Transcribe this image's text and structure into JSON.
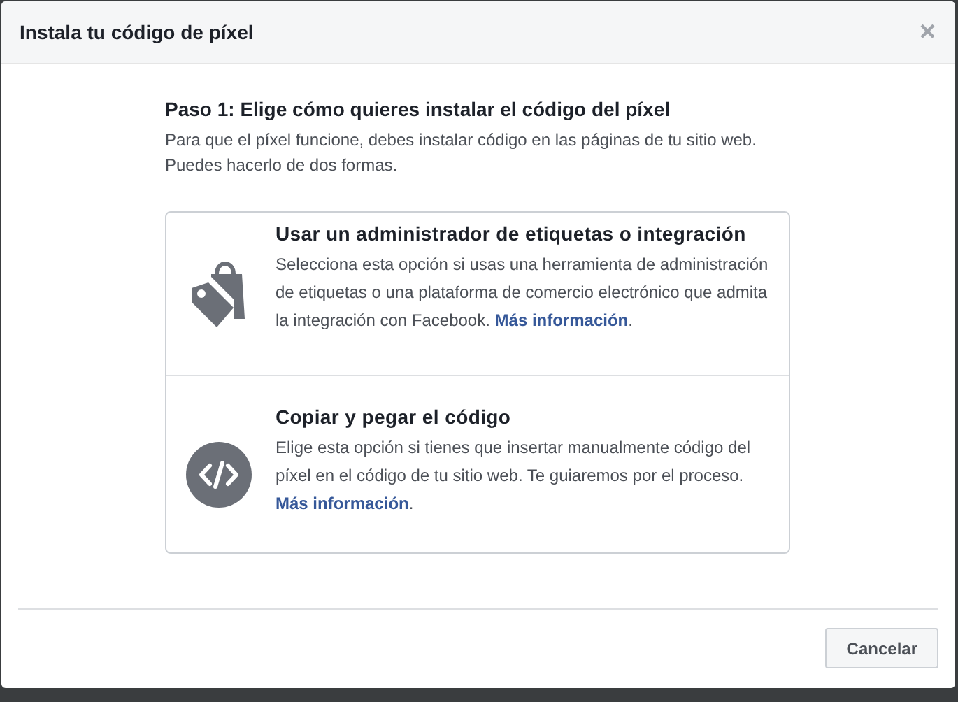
{
  "dialog": {
    "title": "Instala tu código de píxel",
    "close": "×"
  },
  "step": {
    "heading": "Paso 1: Elige cómo quieres instalar el código del píxel",
    "text": "Para que el píxel funcione, debes instalar código en las páginas de tu sitio web. Puedes hacerlo de dos formas."
  },
  "options": [
    {
      "kind": "tag",
      "title": "Usar un administrador de etiquetas o integración",
      "description": "Selecciona esta opción si usas una herramienta de administración de etiquetas o una plataforma de comercio electrónico que admita la integración con Facebook.",
      "link": "Más información",
      "after": "."
    },
    {
      "kind": "code",
      "title": "Copiar y pegar el código",
      "description": "Elige esta opción si tienes que insertar manualmente código del píxel en el código de tu sitio web. Te guiaremos por el proceso.",
      "link": "Más información",
      "after": "."
    }
  ],
  "buttons": [
    "Cancelar"
  ]
}
